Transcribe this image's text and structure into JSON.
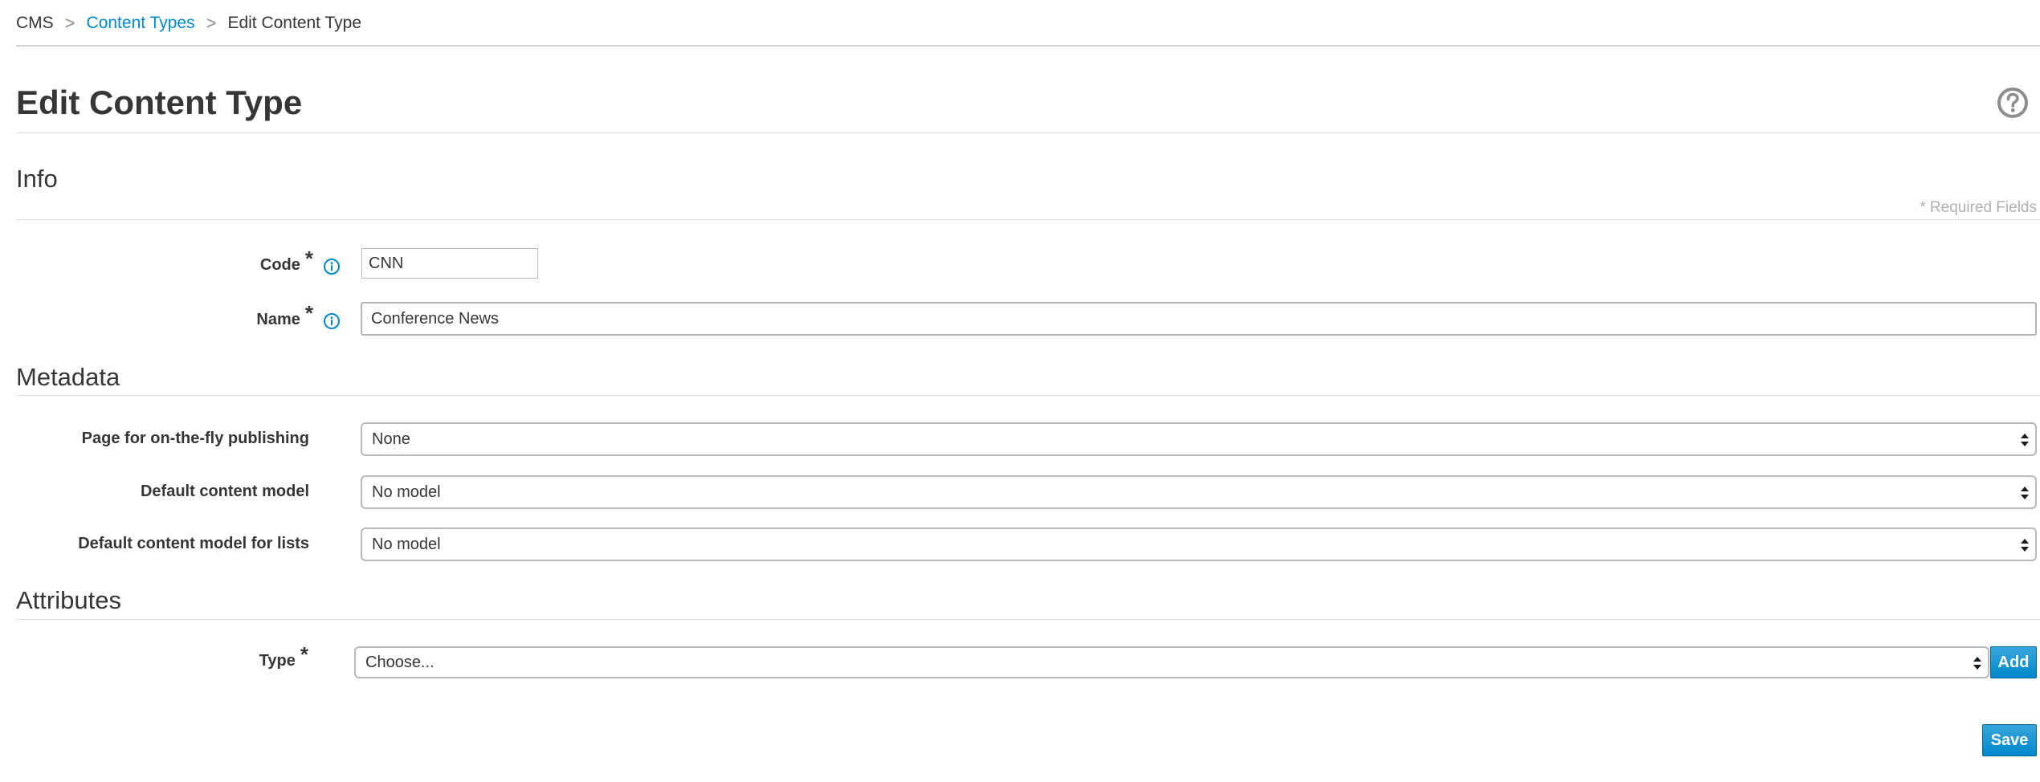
{
  "breadcrumb": {
    "items": [
      "CMS",
      "Content Types",
      "Edit Content Type"
    ],
    "separator": ">"
  },
  "page": {
    "title": "Edit Content Type",
    "help_icon": "question-circle-icon"
  },
  "info": {
    "title": "Info",
    "required_note": "* Required Fields",
    "code_label": "Code",
    "code_value": "CNN",
    "name_label": "Name",
    "name_value": "Conference News",
    "required_marker": "*",
    "info_icon": "info-circle-icon"
  },
  "metadata": {
    "title": "Metadata",
    "page_label": "Page for on-the-fly publishing",
    "page_value": "None",
    "model_label": "Default content model",
    "model_value": "No model",
    "list_model_label": "Default content model for lists",
    "list_model_value": "No model"
  },
  "attributes": {
    "title": "Attributes",
    "type_label": "Type",
    "type_value": "Choose...",
    "add_label": "Add"
  },
  "actions": {
    "save_label": "Save"
  },
  "colors": {
    "link": "#0088ce",
    "button": "#39a5dc",
    "text": "#363636"
  }
}
